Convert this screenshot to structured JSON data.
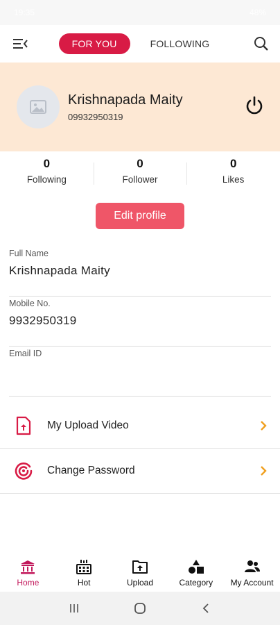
{
  "status_bar": {
    "time": "19:35",
    "battery": "48%"
  },
  "top_nav": {
    "tabs": [
      {
        "label": "FOR YOU",
        "active": true
      },
      {
        "label": "FOLLOWING",
        "active": false
      }
    ]
  },
  "profile": {
    "name": "Krishnapada Maity",
    "phone": "09932950319"
  },
  "stats": [
    {
      "value": "0",
      "label": "Following"
    },
    {
      "value": "0",
      "label": "Follower"
    },
    {
      "value": "0",
      "label": "Likes"
    }
  ],
  "edit_profile_label": "Edit profile",
  "fields": {
    "full_name": {
      "label": "Full Name",
      "value": "Krishnapada Maity"
    },
    "mobile": {
      "label": "Mobile No.",
      "value": "9932950319"
    },
    "email": {
      "label": "Email ID",
      "value": ""
    }
  },
  "menu": [
    {
      "label": "My Upload Video",
      "icon": "upload-file-icon"
    },
    {
      "label": "Change Password",
      "icon": "password-icon"
    }
  ],
  "bottom_nav": [
    {
      "label": "Home",
      "icon": "home-icon",
      "active": true
    },
    {
      "label": "Hot",
      "icon": "hot-icon",
      "active": false
    },
    {
      "label": "Upload",
      "icon": "upload-icon",
      "active": false
    },
    {
      "label": "Category",
      "icon": "category-icon",
      "active": false
    },
    {
      "label": "My Account",
      "icon": "account-icon",
      "active": false
    }
  ],
  "colors": {
    "accent": "#d81b45",
    "button": "#ef5668",
    "header_bg": "#fde8d4",
    "chevron": "#f0a020"
  }
}
